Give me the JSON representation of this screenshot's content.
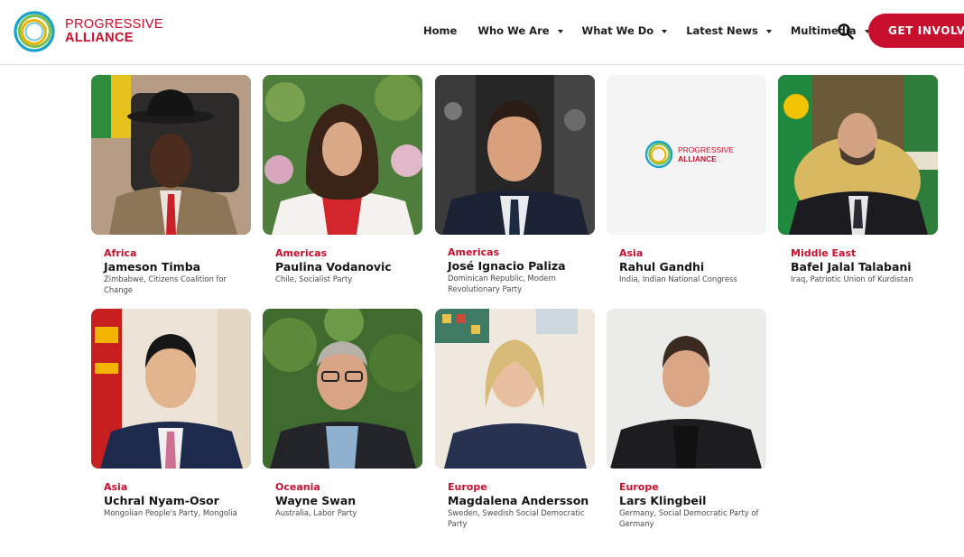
{
  "brand": {
    "line1": "PROGRESSIVE",
    "line2": "ALLIANCE"
  },
  "colors": {
    "accent": "#c8102e",
    "text": "#1c1c1c",
    "muted": "#4a4a4a"
  },
  "nav": {
    "items": [
      {
        "label": "Home",
        "has_dropdown": false
      },
      {
        "label": "Who We Are",
        "has_dropdown": true
      },
      {
        "label": "What We Do",
        "has_dropdown": true
      },
      {
        "label": "Latest News",
        "has_dropdown": true
      },
      {
        "label": "Multimedia",
        "has_dropdown": true
      }
    ],
    "search_icon": "search-icon",
    "cta_label": "GET INVOLVED"
  },
  "people": [
    {
      "region": "Africa",
      "name": "Jameson Timba",
      "affiliation": "Zimbabwe, Citizens Coalition for Change"
    },
    {
      "region": "Americas",
      "name": "Paulina Vodanovic",
      "affiliation": "Chile, Socialist Party"
    },
    {
      "region": "Americas",
      "name": "José Ignacio Paliza",
      "affiliation": "Dominican Republic, Modern Revolutionary Party"
    },
    {
      "region": "Asia",
      "name": "Rahul Gandhi",
      "affiliation": "India, Indian National Congress"
    },
    {
      "region": "Middle East",
      "name": "Bafel Jalal Talabani",
      "affiliation": "Iraq, Patriotic Union of Kurdistan"
    },
    {
      "region": "Asia",
      "name": "Uchral Nyam-Osor",
      "affiliation": "Mongolian People's Party, Mongolia"
    },
    {
      "region": "Oceania",
      "name": "Wayne Swan",
      "affiliation": "Australia, Labor Party"
    },
    {
      "region": "Europe",
      "name": "Magdalena Andersson",
      "affiliation": "Sweden, Swedish Social Democratic Party"
    },
    {
      "region": "Europe",
      "name": "Lars Klingbeil",
      "affiliation": "Germany, Social Democratic Party of Germany"
    }
  ],
  "placeholder_logo": {
    "line1": "PROGRESSIVE",
    "line2": "ALLIANCE"
  }
}
